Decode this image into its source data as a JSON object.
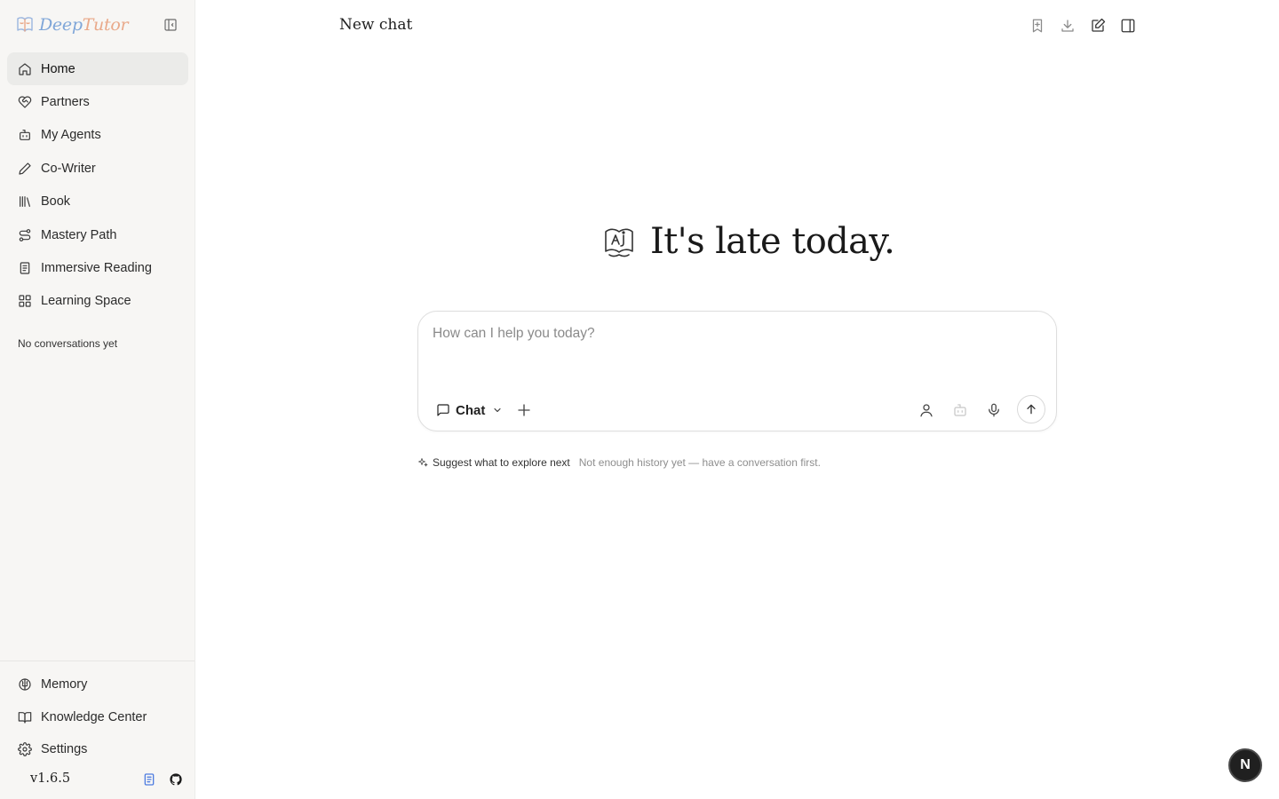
{
  "brand": {
    "name_part1": "Deep",
    "name_part2": "Tutor",
    "logo_icon": "brain-book-logo-icon"
  },
  "sidebar": {
    "items": [
      {
        "label": "Home",
        "icon": "home-icon",
        "active": true
      },
      {
        "label": "Partners",
        "icon": "heart-handshake-icon"
      },
      {
        "label": "My Agents",
        "icon": "bot-icon"
      },
      {
        "label": "Co-Writer",
        "icon": "pen-icon"
      },
      {
        "label": "Book",
        "icon": "library-icon"
      },
      {
        "label": "Mastery Path",
        "icon": "route-icon"
      },
      {
        "label": "Immersive Reading",
        "icon": "notebook-icon"
      },
      {
        "label": "Learning Space",
        "icon": "grid-icon"
      }
    ],
    "empty_text": "No conversations yet",
    "bottom_items": [
      {
        "label": "Memory",
        "icon": "brain-icon"
      },
      {
        "label": "Knowledge Center",
        "icon": "book-open-icon"
      },
      {
        "label": "Settings",
        "icon": "gear-icon"
      }
    ],
    "version": "v1.6.5"
  },
  "header": {
    "title": "New chat",
    "actions": [
      "bookmark-icon",
      "download-icon",
      "edit-square-icon",
      "panel-right-icon"
    ]
  },
  "hero": {
    "greeting": "It's late today."
  },
  "composer": {
    "placeholder": "How can I help you today?",
    "value": "",
    "mode_label": "Chat",
    "tools": [
      "user-icon",
      "bot-icon",
      "mic-icon",
      "send-arrow-icon"
    ]
  },
  "suggest": {
    "button_label": "Suggest what to explore next",
    "hint": "Not enough history yet — have a conversation first."
  },
  "fab": {
    "label": "N"
  },
  "colors": {
    "accent_blue": "#7fa6d8",
    "accent_peach": "#e9a98a",
    "sidebar_bg": "#f7f6f4",
    "active_item_bg": "#ebebe9"
  }
}
